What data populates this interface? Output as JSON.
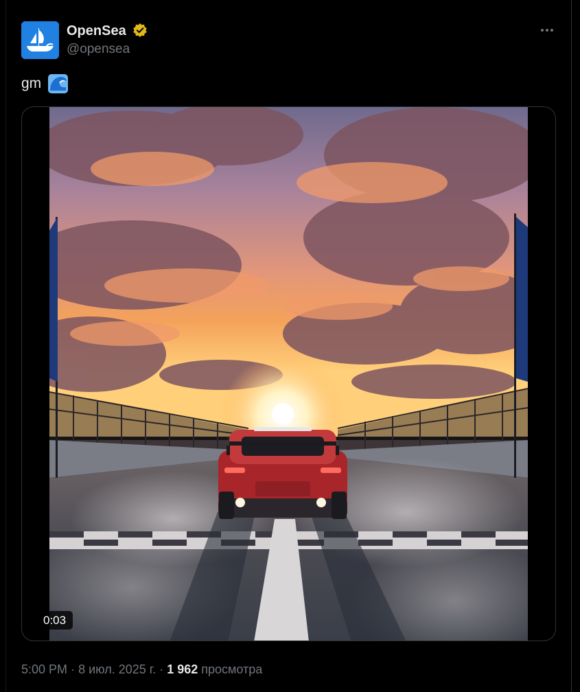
{
  "author": {
    "name": "OpenSea",
    "handle": "@opensea",
    "verified": true,
    "avatar_icon": "opensea-logo-icon",
    "avatar_color": "#2081e2"
  },
  "tweet": {
    "text": "gm",
    "emoji_icon": "water-wave-icon"
  },
  "media": {
    "type": "video",
    "duration": "0:03"
  },
  "footer": {
    "time": "5:00 PM",
    "separator": "·",
    "date": "8 июл. 2025 г.",
    "views_count": "1 962",
    "views_label": "просмотра"
  },
  "menu": {
    "icon": "more-options-icon"
  },
  "colors": {
    "background": "#000000",
    "text": "#e7e9ea",
    "secondary_text": "#71767b",
    "verified_gold": "#e2b719",
    "border": "#2f3336"
  }
}
